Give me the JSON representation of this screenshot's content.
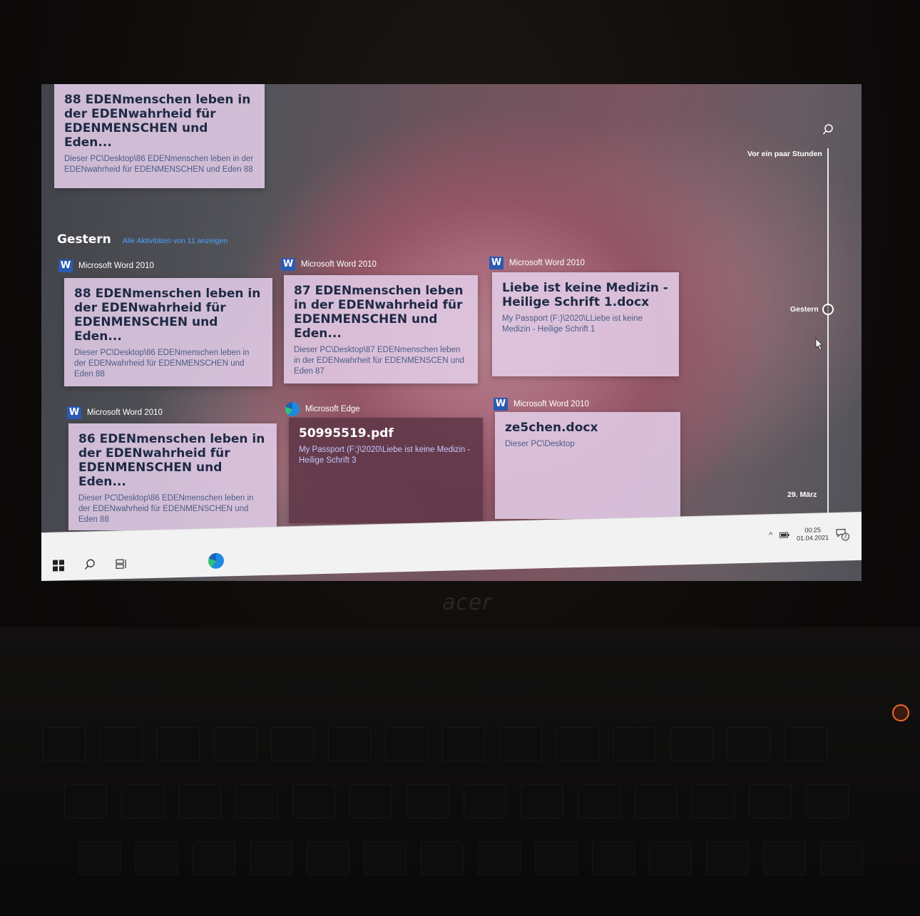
{
  "top_card": {
    "title": "88 EDENmenschen leben in der EDENwahrheid für EDENMENSCHEN und Eden...",
    "subtitle": "Dieser PC\\Desktop\\86 EDENmenschen leben in der EDENwahrheid für EDENMENSCHEN und Eden 88"
  },
  "section": {
    "title": "Gestern",
    "link": "Alle Aktivitäten von 11 anzeigen"
  },
  "cards": [
    {
      "app": "Microsoft Word 2010",
      "icon": "word-icon",
      "title": "88 EDENmenschen leben in der EDENwahrheid für EDENMENSCHEN und Eden...",
      "subtitle": "Dieser PC\\Desktop\\86 EDENmenschen leben in der EDENwahrheid für EDENMENSCHEN und Eden 88"
    },
    {
      "app": "Microsoft Word 2010",
      "icon": "word-icon",
      "title": "87 EDENmenschen leben in der EDENwahrheid für EDENMENSCHEN und Eden...",
      "subtitle": "Dieser PC\\Desktop\\87  EDENmenschen leben in der EDENwahrheit für EDENMENSCEN und Eden 87"
    },
    {
      "app": "Microsoft Word 2010",
      "icon": "word-icon",
      "title": "Liebe ist keine Medizin - Heilige Schrift 1.docx",
      "subtitle": "My Passport (F:)\\2020\\LLiebe ist keine Medizin - Heilige Schrift 1"
    },
    {
      "app": "Microsoft Word 2010",
      "icon": "word-icon",
      "title": "86 EDENmenschen leben in der EDENwahrheid für EDENMENSCHEN und Eden...",
      "subtitle": "Dieser PC\\Desktop\\86 EDENmenschen leben in der EDENwahrheid für EDENMENSCHEN und Eden 88"
    },
    {
      "app": "Microsoft Edge",
      "icon": "edge-icon",
      "title": "50995519.pdf",
      "subtitle": "My Passport (F:)\\2020\\Liebe ist keine Medizin - Heilige Schrift 3"
    },
    {
      "app": "Microsoft Word 2010",
      "icon": "word-icon",
      "title": "ze5chen.docx",
      "subtitle": "Dieser PC\\Desktop"
    }
  ],
  "timeline": {
    "top_label": "Vor ein paar Stunden",
    "current_label": "Gestern",
    "bottom_label": "29. März"
  },
  "taskbar": {
    "time": "00:25",
    "date": "01.04.2021",
    "notification_count": "2"
  },
  "laptop_brand": "acer",
  "colors": {
    "card_bg": "#e2cce7",
    "card_title": "#1f2a44",
    "card_subtitle": "#4b5d84",
    "link": "#4aa3ff",
    "edge_card_bg": "#5f3748"
  }
}
